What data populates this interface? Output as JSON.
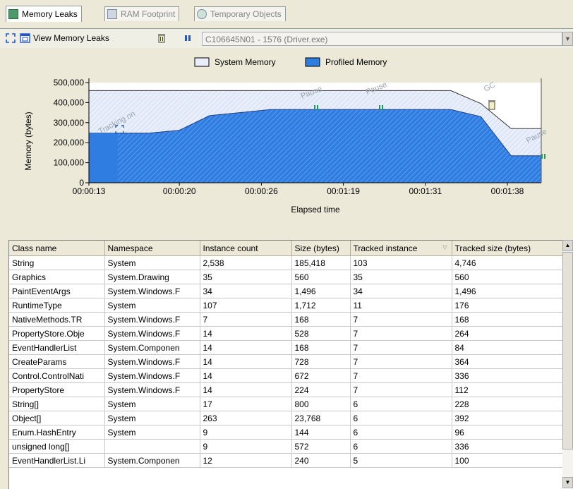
{
  "tabs": [
    {
      "label": "Memory Leaks",
      "active": true
    },
    {
      "label": "RAM Footprint",
      "active": false
    },
    {
      "label": "Temporary Objects",
      "active": false
    }
  ],
  "toolbar": {
    "view_leaks_label": "View Memory Leaks",
    "process_selected": "C106645N01 - 1576 (Driver.exe)"
  },
  "chart_data": {
    "type": "area",
    "legend": {
      "position": "top",
      "entries": [
        "System Memory",
        "Profiled Memory"
      ]
    },
    "colors": {
      "system": "#e8eefa",
      "profiled": "#2f7de1",
      "axis": "#000000"
    },
    "xlabel": "Elapsed time",
    "ylabel": "Memory (bytes)",
    "ylim": [
      0,
      500000
    ],
    "y_ticks": [
      "500,000",
      "400,000",
      "300,000",
      "200,000",
      "100,000",
      "0"
    ],
    "x_ticks": [
      "00:00:13",
      "00:00:20",
      "00:00:26",
      "00:01:19",
      "00:01:31",
      "00:01:38"
    ],
    "series": [
      {
        "name": "System Memory",
        "values": [
          460000,
          460000,
          460000,
          460000,
          460000,
          460000,
          460000,
          460000,
          460000,
          460000,
          460000,
          460000,
          460000,
          395000,
          270000,
          270000
        ]
      },
      {
        "name": "Profiled Memory",
        "values": [
          248000,
          248000,
          248000,
          262000,
          335000,
          350000,
          365000,
          365000,
          365000,
          365000,
          365000,
          365000,
          365000,
          330000,
          135000,
          135000
        ]
      }
    ],
    "annotations": [
      "Tracking on",
      "Pause",
      "Pause",
      "GC",
      "Pause"
    ]
  },
  "table": {
    "columns": [
      "Class name",
      "Namespace",
      "Instance count",
      "Size (bytes)",
      "Tracked instance",
      "Tracked size (bytes)"
    ],
    "rows": [
      [
        "String",
        "System",
        "2,538",
        "185,418",
        "103",
        "4,746"
      ],
      [
        "Graphics",
        "System.Drawing",
        "35",
        "560",
        "35",
        "560"
      ],
      [
        "PaintEventArgs",
        "System.Windows.F",
        "34",
        "1,496",
        "34",
        "1,496"
      ],
      [
        "RuntimeType",
        "System",
        "107",
        "1,712",
        "11",
        "176"
      ],
      [
        "NativeMethods.TR",
        "System.Windows.F",
        "7",
        "168",
        "7",
        "168"
      ],
      [
        "PropertyStore.Obje",
        "System.Windows.F",
        "14",
        "528",
        "7",
        "264"
      ],
      [
        "EventHandlerList",
        "System.Componen",
        "14",
        "168",
        "7",
        "84"
      ],
      [
        "CreateParams",
        "System.Windows.F",
        "14",
        "728",
        "7",
        "364"
      ],
      [
        "Control.ControlNati",
        "System.Windows.F",
        "14",
        "672",
        "7",
        "336"
      ],
      [
        "PropertyStore",
        "System.Windows.F",
        "14",
        "224",
        "7",
        "112"
      ],
      [
        "String[]",
        "System",
        "17",
        "800",
        "6",
        "228"
      ],
      [
        "Object[]",
        "System",
        "263",
        "23,768",
        "6",
        "392"
      ],
      [
        "Enum.HashEntry",
        "System",
        "9",
        "144",
        "6",
        "96"
      ],
      [
        "unsigned long[]",
        "",
        "9",
        "572",
        "6",
        "336"
      ],
      [
        "EventHandlerList.Li",
        "System.Componen",
        "12",
        "240",
        "5",
        "100"
      ]
    ]
  }
}
